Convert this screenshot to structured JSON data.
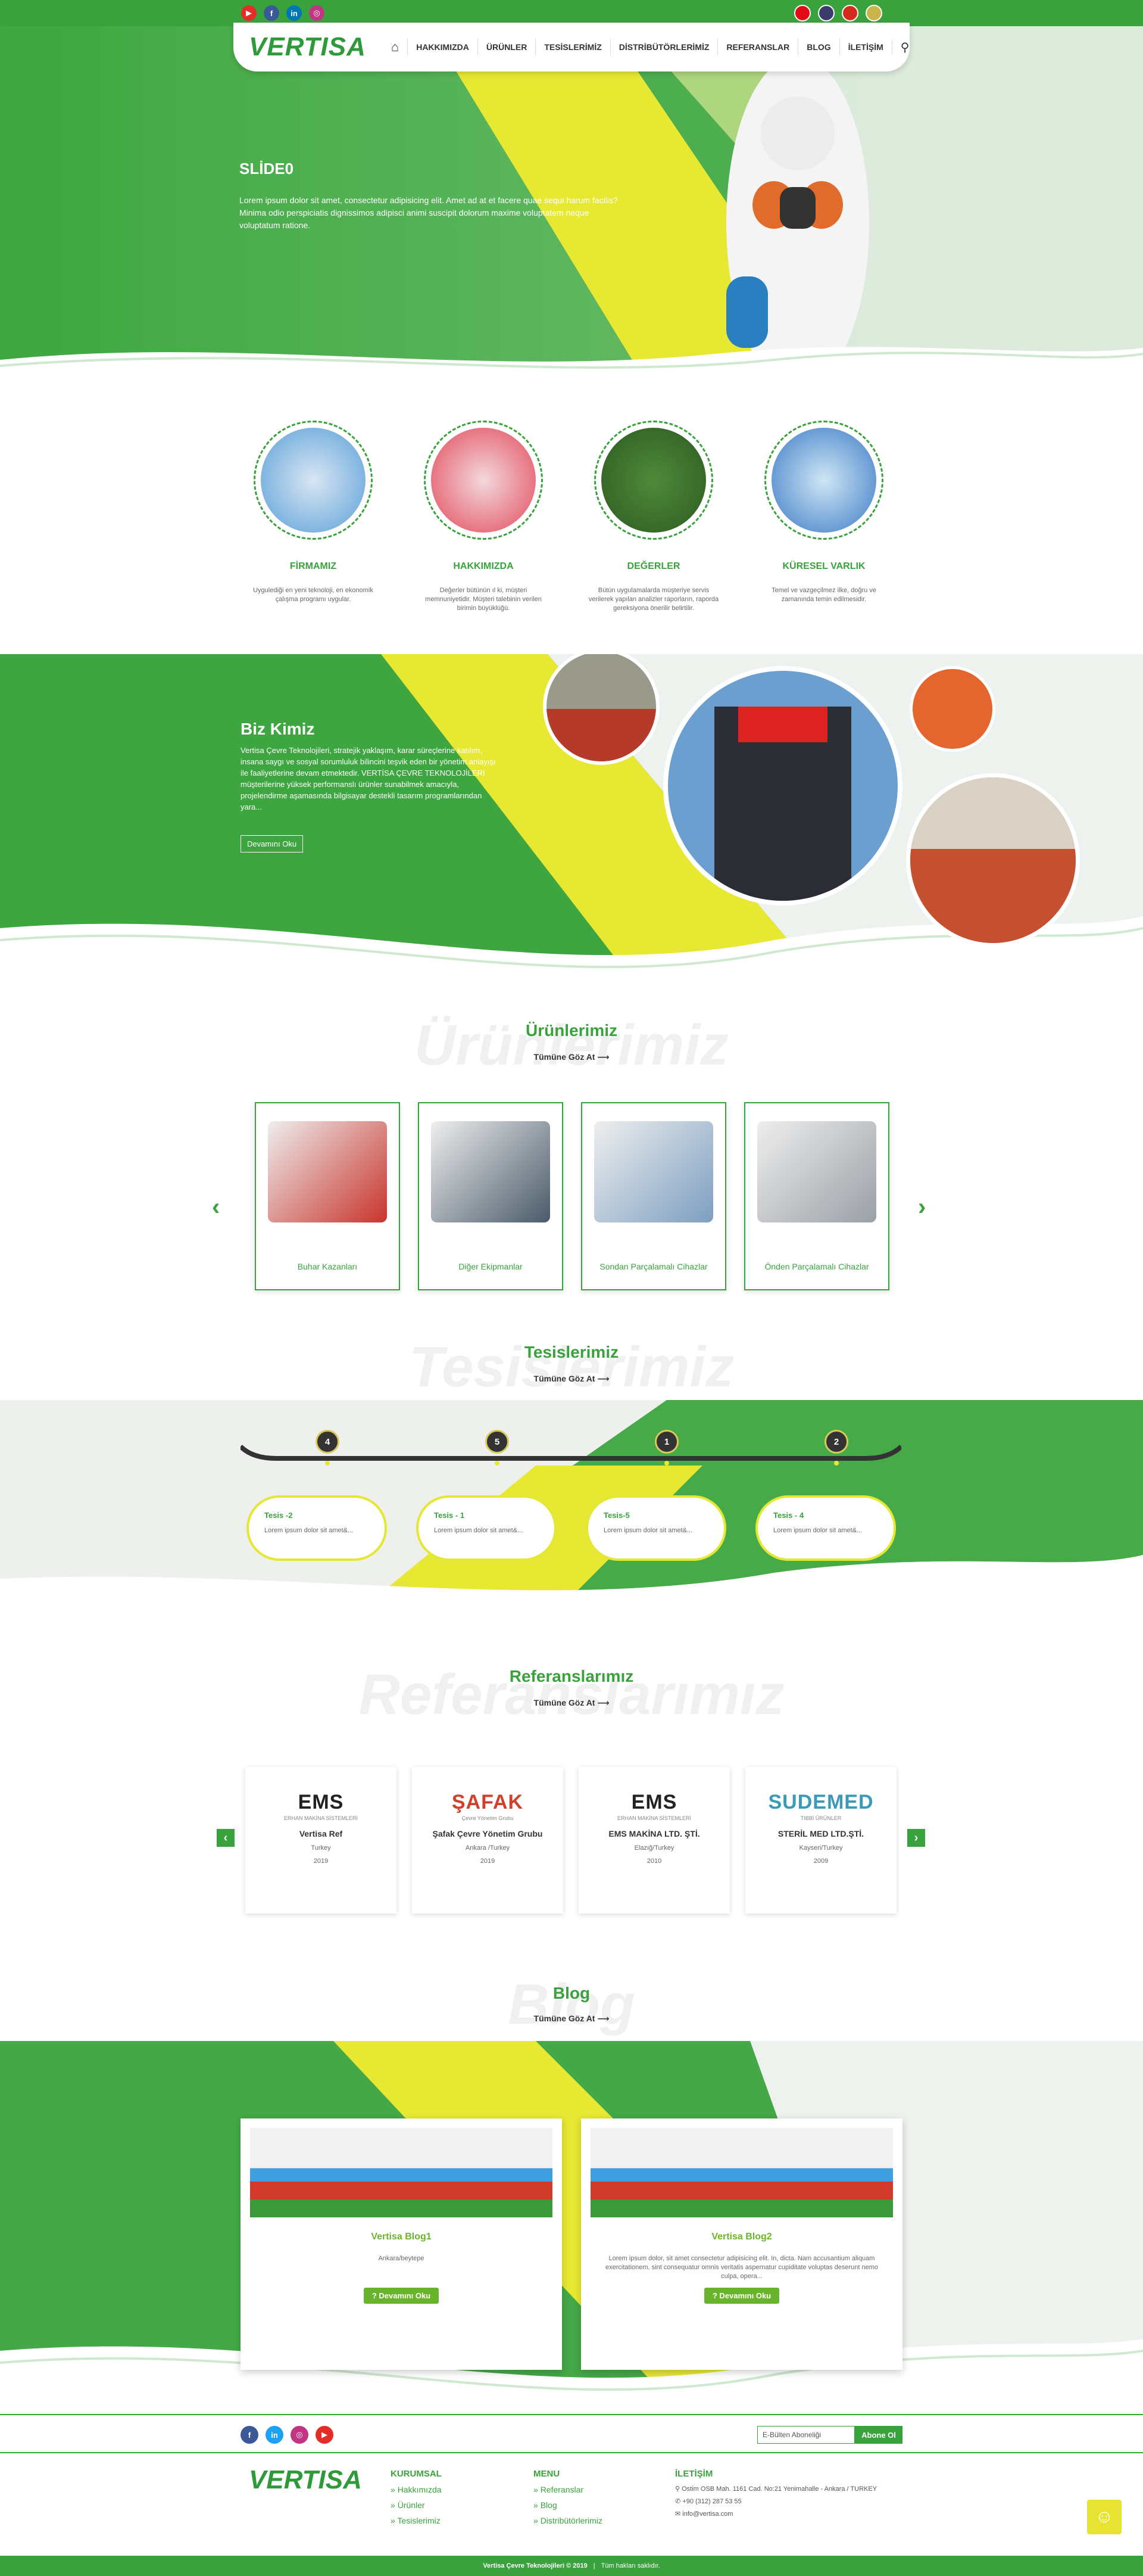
{
  "brand": {
    "logo": "VERTISA",
    "accent": "#3aa23d",
    "yellow": "#e4e832"
  },
  "topbar": {
    "socials": [
      {
        "icon": "youtube-icon",
        "glyph": "▶",
        "color": "#e52d27"
      },
      {
        "icon": "facebook-icon",
        "glyph": "f",
        "color": "#3b5998"
      },
      {
        "icon": "linkedin-icon",
        "glyph": "in",
        "color": "#0077b5"
      },
      {
        "icon": "instagram-icon",
        "glyph": "◎",
        "color": "#c13584"
      }
    ],
    "languages": [
      "turkish-flag-icon",
      "english-flag-icon",
      "russian-flag-icon",
      "arabic-flag-icon"
    ]
  },
  "nav": {
    "home_icon": "⌂",
    "items": [
      "HAKKIMIZDA",
      "ÜRÜNLER",
      "TESİSLERİMİZ",
      "DİSTRİBÜTÖRLERİMİZ",
      "REFERANSLAR",
      "BLOG",
      "İLETİŞİM"
    ],
    "search_icon": "⚲"
  },
  "hero": {
    "title": "SLİDE0",
    "text": "Lorem ipsum dolor sit amet, consectetur adipisicing elit. Amet ad at et facere quae sequi harum facilis? Minima odio perspiciatis dignissimos adipisci animi suscipit dolorum maxime voluptatem neque voluptatum ratione."
  },
  "features": [
    {
      "title": "FİRMAMIZ",
      "desc": "Uygulediği en yeni teknoloji, en ekonomik çalışma programı uygular."
    },
    {
      "title": "HAKKIMIZDA",
      "desc": "Değerler bütünün ıl ki, müşteri memnuniyetidir. Müşteri talebinin verilen birimin büyüklüğü."
    },
    {
      "title": "DEĞERLER",
      "desc": "Bütün uygulamalarda müşteriye servis verilerek yapılan analizler raporların, raporda gereksiyona önerilir belirtilir."
    },
    {
      "title": "KÜRESEL VARLIK",
      "desc": "Temel ve vazgeçilmez ilke, doğru ve zamanında temin edilmesidir."
    }
  ],
  "about": {
    "title": "Biz Kimiz",
    "text": "Vertisa Çevre Teknolojileri, stratejik yaklaşım, karar süreçlerine katılım, insana saygı ve sosyal sorumluluk bilincini teşvik eden bir yönetim anlayışı ile faaliyetlerine devam etmektedir. VERTİSA ÇEVRE TEKNOLOJİLERİ müşterilerine yüksek performanslı ürünler sunabilmek amacıyla, projelendirme aşamasında bilgisayar destekli tasarım programlarından yara...",
    "button": "Devamını Oku"
  },
  "products": {
    "title": "Ürünlerimiz",
    "ghost": "Ürünlerimiz",
    "all": "Tümüne Göz At",
    "items": [
      "Buhar Kazanları",
      "Diğer Ekipmanlar",
      "Sondan Parçalamalı Cihazlar",
      "Önden Parçalamalı Cihazlar"
    ]
  },
  "facilities": {
    "title": "Tesislerimiz",
    "ghost": "Tesislerimiz",
    "all": "Tümüne Göz At",
    "nums": [
      "4",
      "5",
      "1",
      "2"
    ],
    "items": [
      {
        "title": "Tesis -2",
        "desc": "Lorem ipsum dolor sit amet&..."
      },
      {
        "title": "Tesis - 1",
        "desc": "Lorem ipsum dolor sit amet&..."
      },
      {
        "title": "Tesis-5",
        "desc": "Lorem ipsum dolor sit amet&..."
      },
      {
        "title": "Tesis - 4",
        "desc": "Lorem ipsum dolor sit amet&..."
      }
    ]
  },
  "references": {
    "title": "Referanslarımız",
    "ghost": "Referanslarımız",
    "all": "Tümüne Göz At",
    "items": [
      {
        "logo": "EMS",
        "logo_sub": "ERHAN MAKİNA SİSTEMLERİ",
        "name": "Vertisa Ref",
        "place": "Turkey",
        "year": "2019"
      },
      {
        "logo": "ŞAFAK",
        "logo_sub": "Çevre Yönetim Grubu",
        "name": "Şafak Çevre Yönetim Grubu",
        "place": "Ankara /Turkey",
        "year": "2019"
      },
      {
        "logo": "EMS",
        "logo_sub": "ERHAN MAKİNA SİSTEMLERİ",
        "name": "EMS MAKİNA LTD. ŞTİ.",
        "place": "Elazığ/Turkey",
        "year": "2010"
      },
      {
        "logo": "SUDEMED",
        "logo_sub": "TIBBİ ÜRÜNLER",
        "name": "STERİL MED LTD.ŞTİ.",
        "place": "Kayseri/Turkey",
        "year": "2009"
      }
    ]
  },
  "blog": {
    "title": "Blog",
    "ghost": "Blog",
    "all": "Tümüne Göz At",
    "items": [
      {
        "title": "Vertisa Blog1",
        "text": "Ankara/beytepe",
        "button": "Devamını Oku"
      },
      {
        "title": "Vertisa Blog2",
        "text": "Lorem ipsum dolor, sit amet consectetur adipisicing elit. In, dicta. Nam accusantium aliquam exercitationem, sint consequatur omnis veritatis aspernatur cupiditate voluptas deserunt nemo culpa, opera...",
        "button": "Devamını Oku"
      }
    ]
  },
  "footer": {
    "newsletter_placeholder": "E-Bülten Aboneliği",
    "newsletter_button": "Abone Ol",
    "cols": [
      {
        "title": "KURUMSAL",
        "links": [
          "Hakkımızda",
          "Ürünler",
          "Tesislerimiz"
        ]
      },
      {
        "title": "MENU",
        "links": [
          "Referanslar",
          "Blog",
          "Distribütörlerimiz"
        ]
      }
    ],
    "contact": {
      "title": "İLETİŞİM",
      "address": "Ostim OSB Mah. 1161 Cad. No:21 Yenimahalle - Ankara / TURKEY",
      "phone": "+90 (312) 287 53 55",
      "email": "info@vertisa.com"
    },
    "copyright": "Vertisa Çevre Teknolojileri © 2019",
    "rights": "Tüm hakları saklıdır."
  }
}
